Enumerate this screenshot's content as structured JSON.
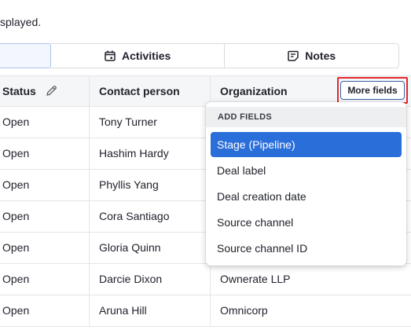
{
  "intro_text": "splayed.",
  "tabs": {
    "activities": "Activities",
    "notes": "Notes"
  },
  "table": {
    "columns": {
      "status": "Status",
      "contact": "Contact person",
      "organization": "Organization"
    },
    "more_fields": "More fields",
    "rows": [
      {
        "status": "Open",
        "contact": "Tony Turner",
        "organization": ""
      },
      {
        "status": "Open",
        "contact": "Hashim Hardy",
        "organization": ""
      },
      {
        "status": "Open",
        "contact": "Phyllis Yang",
        "organization": ""
      },
      {
        "status": "Open",
        "contact": "Cora Santiago",
        "organization": ""
      },
      {
        "status": "Open",
        "contact": "Gloria Quinn",
        "organization": ""
      },
      {
        "status": "Open",
        "contact": "Darcie Dixon",
        "organization": "Ownerate LLP"
      },
      {
        "status": "Open",
        "contact": "Aruna Hill",
        "organization": "Omnicorp"
      }
    ]
  },
  "dropdown": {
    "header": "ADD FIELDS",
    "items": [
      {
        "label": "Stage (Pipeline)",
        "selected": true
      },
      {
        "label": "Deal label",
        "selected": false
      },
      {
        "label": "Deal creation date",
        "selected": false
      },
      {
        "label": "Source channel",
        "selected": false
      },
      {
        "label": "Source channel ID",
        "selected": false
      }
    ]
  },
  "colors": {
    "accent": "#2a6ed9",
    "highlight_border": "#e4262b"
  }
}
